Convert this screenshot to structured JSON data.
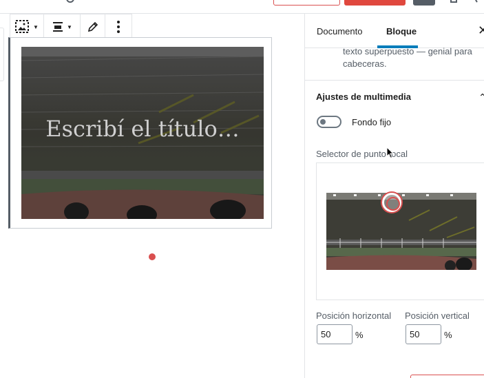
{
  "toolbar": {
    "buttons": [
      "replace-media",
      "align",
      "edit",
      "more-options"
    ]
  },
  "cover": {
    "title": "Escribí el título…"
  },
  "sidebar": {
    "tabs": [
      "Documento",
      "Bloque"
    ],
    "active_tab": "Bloque",
    "description": "texto superpuesto — genial para cabeceras.",
    "media_panel": {
      "title": "Ajustes de multimedia",
      "fixed_bg_label": "Fondo fijo",
      "fixed_bg_enabled": false,
      "focal_label": "Selector de punto focal",
      "horizontal_label": "Posición horizontal",
      "vertical_label": "Posición vertical",
      "horizontal_value": "50",
      "vertical_value": "50",
      "unit": "%"
    }
  },
  "colors": {
    "accent": "#007cba",
    "danger": "#d94f4f",
    "text": "#1e1e1e"
  }
}
